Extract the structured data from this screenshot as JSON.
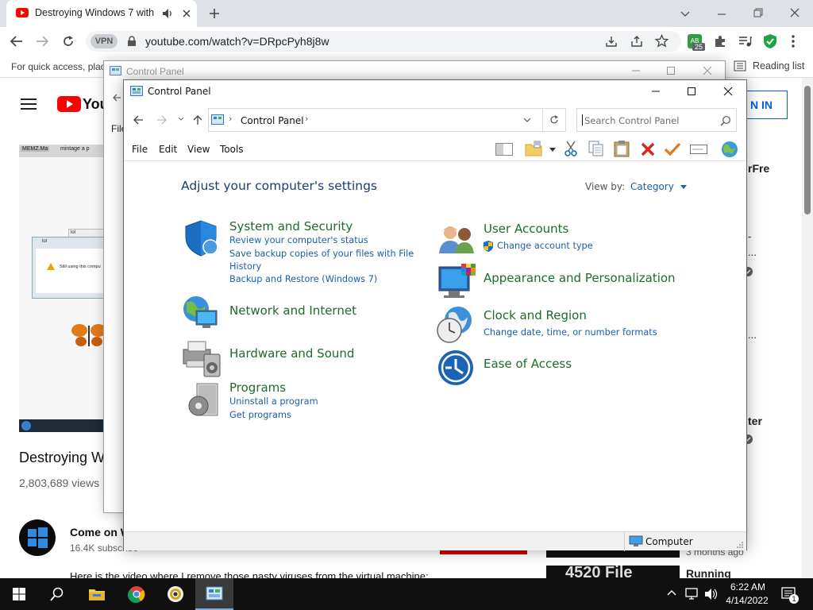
{
  "browser": {
    "tab_title": "Destroying Windows 7 with",
    "url": "youtube.com/watch?v=DRpcPyh8j8w",
    "vpn_label": "VPN",
    "bookmarks_hint": "For quick access, plac",
    "reading_list": "Reading list",
    "extension_badge": "25",
    "extension_letters": "AB"
  },
  "youtube": {
    "sign_in": "N IN",
    "video_title": "Destroying W",
    "views": "2,803,689 views",
    "channel_name": "Come on W",
    "subscribers": "16.4K subscribe",
    "description": "Here is the video where I remove those nasty viruses from the virtual machine:",
    "thumb_tab1": "MEMZ.Ma",
    "thumb_tab2": "mintage a p",
    "thumb_dialog_title": "lol",
    "thumb_dialog_text": "Still using this compu",
    "thumb_small_title": "lol",
    "side_text_1": "rFre",
    "side_text_2": "-",
    "side_text_3": "...",
    "side_text_4": "...",
    "side_text_5": "ter",
    "months_ago": "3 months ago",
    "running": "Running",
    "side_thumb_text": "4520 File"
  },
  "cp_back": {
    "title": "Control Panel",
    "menu": "File"
  },
  "cp": {
    "title": "Control Panel",
    "breadcrumb": "Control Panel",
    "search_placeholder": "Search Control Panel",
    "menu": [
      "File",
      "Edit",
      "View",
      "Tools"
    ],
    "heading": "Adjust your computer's settings",
    "view_by_label": "View by:",
    "view_by_value": "Category",
    "categories_left": [
      {
        "title": "System and Security",
        "links": [
          "Review your computer's status",
          "Save backup copies of your files with File",
          "History",
          "Backup and Restore (Windows 7)"
        ]
      },
      {
        "title": "Network and Internet",
        "links": []
      },
      {
        "title": "Hardware and Sound",
        "links": []
      },
      {
        "title": "Programs",
        "links": [
          "Uninstall a program",
          "Get programs"
        ]
      }
    ],
    "categories_right": [
      {
        "title": "User Accounts",
        "links": [
          "Change account type"
        ]
      },
      {
        "title": "Appearance and Personalization",
        "links": []
      },
      {
        "title": "Clock and Region",
        "links": [
          "Change date, time, or number formats"
        ]
      },
      {
        "title": "Ease of Access",
        "links": []
      }
    ],
    "status": "Computer"
  },
  "taskbar": {
    "time": "6:22 AM",
    "date": "4/14/2022",
    "notifications": "1"
  }
}
